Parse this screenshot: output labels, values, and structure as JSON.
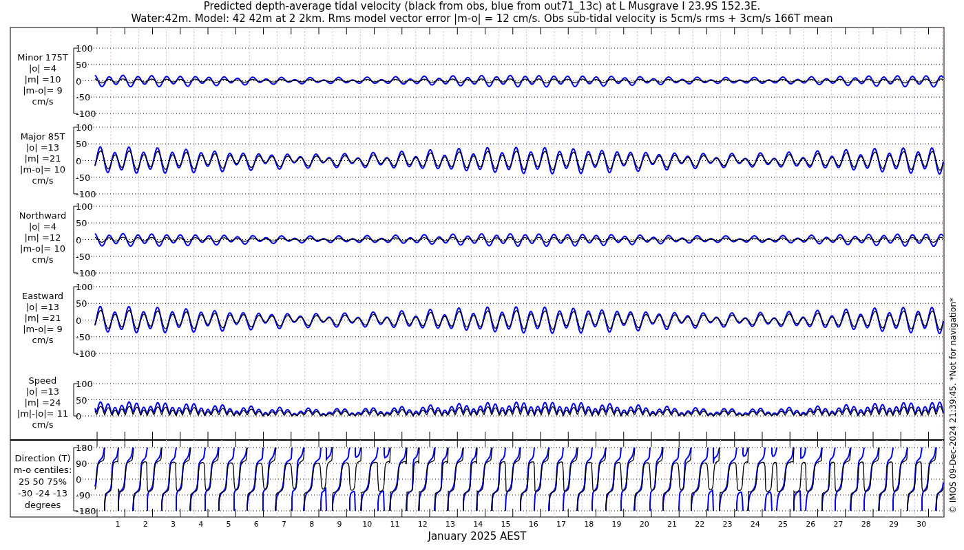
{
  "title": "Predicted depth-average tidal velocity (black from obs, blue from out71_13c) at L Musgrave I 23.9S 152.3E.",
  "subtitle": "Water:42m. Model: 42 42m at 2 2km. Rms model vector error |m-o| = 12 cm/s. Obs sub-tidal velocity is 5cm/s rms + 3cm/s 166T mean",
  "panels": [
    {
      "kind": "minor",
      "label_lines": [
        "Minor 175T",
        "|o| =4",
        "|m| =10",
        "|m-o|= 9",
        "cm/s"
      ],
      "yticks": [
        "100",
        "50",
        "0",
        "-50",
        "-100"
      ]
    },
    {
      "kind": "major",
      "label_lines": [
        "Major 85T",
        "|o| =13",
        "|m| =21",
        "|m-o|= 10",
        "cm/s"
      ],
      "yticks": [
        "100",
        "50",
        "0",
        "-50",
        "-100"
      ]
    },
    {
      "kind": "north",
      "label_lines": [
        "Northward",
        "|o| =4",
        "|m| =12",
        "|m-o|= 10",
        "cm/s"
      ],
      "yticks": [
        "100",
        "50",
        "0",
        "-50",
        "-100"
      ]
    },
    {
      "kind": "east",
      "label_lines": [
        "Eastward",
        "|o| =13",
        "|m| =21",
        "|m-o|= 9",
        "cm/s"
      ],
      "yticks": [
        "100",
        "50",
        "0",
        "-50",
        "-100"
      ]
    },
    {
      "kind": "speed",
      "label_lines": [
        "Speed",
        "|o| =13",
        "|m| =24",
        "|m|-|o|= 11",
        "cm/s"
      ],
      "yticks": [
        "100",
        "50",
        "0"
      ]
    },
    {
      "kind": "direction",
      "label_lines": [
        "Direction (T)",
        "m-o centiles:",
        "25  50  75%",
        "-30 -24 -13",
        "degrees"
      ],
      "yticks": [
        "180",
        "90",
        "0",
        "-90",
        "-180"
      ]
    }
  ],
  "days": [
    "1",
    "2",
    "3",
    "4",
    "5",
    "6",
    "7",
    "8",
    "9",
    "10",
    "11",
    "12",
    "13",
    "14",
    "15",
    "16",
    "17",
    "18",
    "19",
    "20",
    "21",
    "22",
    "23",
    "24",
    "25",
    "26",
    "27",
    "28",
    "29",
    "30"
  ],
  "xlabel": "January 2025 AEST",
  "footer": "© IMOS 09-Dec-2024 21:39:45. *Not for navigation*"
}
